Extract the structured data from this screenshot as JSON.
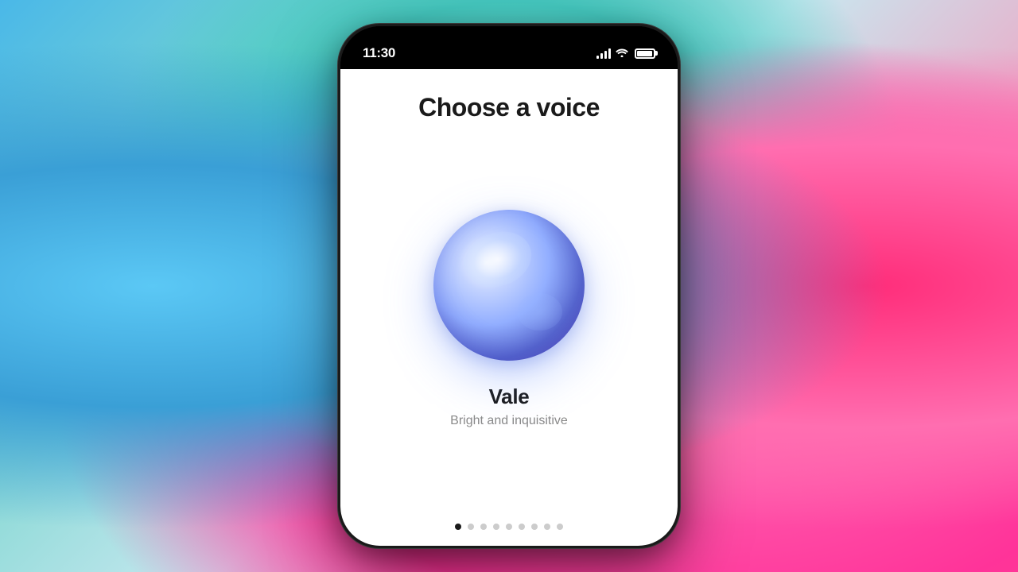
{
  "background": {
    "description": "colorful painted canvas background with blue, teal, and pink/magenta areas"
  },
  "status_bar": {
    "time": "11:30",
    "signal_full": true,
    "wifi": true,
    "battery_full": true
  },
  "screen": {
    "title": "Choose a voice",
    "current_voice": {
      "name": "Vale",
      "description": "Bright and inquisitive"
    },
    "pagination": {
      "total_dots": 9,
      "active_index": 0
    }
  }
}
